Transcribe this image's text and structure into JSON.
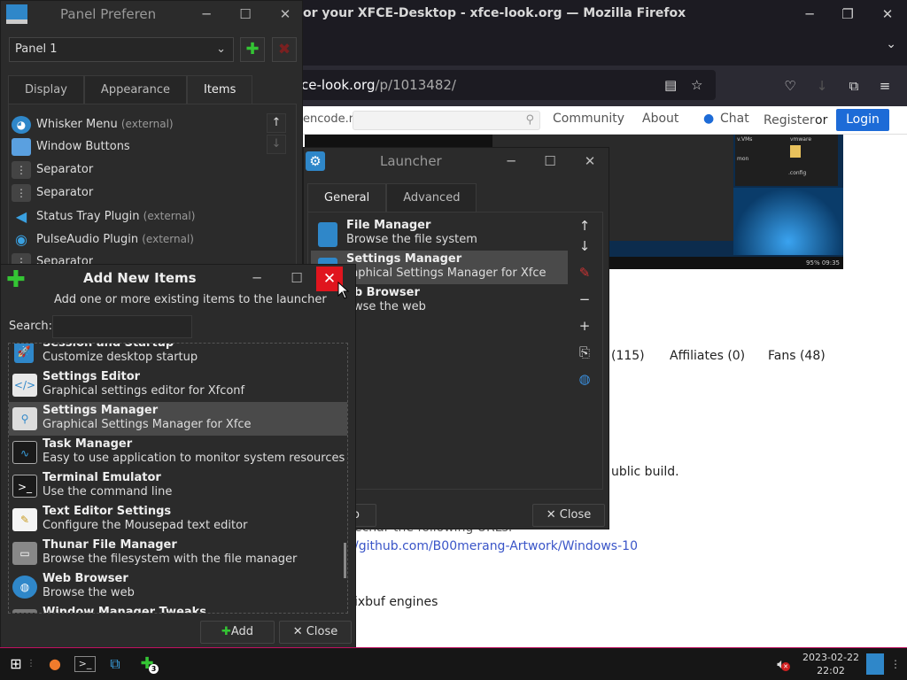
{
  "firefox": {
    "title": "or your XFCE-Desktop - xfce-look.org — Mozilla Firefox",
    "url_host": "ce-look.org",
    "url_path": "/p/1013482/",
    "site": {
      "opencode_fragment": "encode.n",
      "nav": [
        "Community",
        "About",
        "Chat"
      ],
      "register": "Register",
      "or": "or",
      "login": "Login"
    },
    "screenshot_text": {
      "vms": "v.VMs",
      "vmware": "vmware",
      "mon": "mon",
      "config": ".config",
      "status": "95% 09:35"
    },
    "tab_count_frag": "(115)",
    "affiliates": "Affiliates (0)",
    "fans": "Fans (48)",
    "public_build": "ublic build.",
    "urls_frag": "ecnar the following URLs.",
    "github_link": "/github.com/B00merang-Artwork/Windows-10",
    "pixbuf": "ixbuf engines"
  },
  "panel_prefs": {
    "title": "Panel Preferen",
    "panel_select": "Panel 1",
    "tabs": [
      "Display",
      "Appearance",
      "Items"
    ],
    "active_tab": 2,
    "items": [
      {
        "label": "Whisker Menu",
        "ext": "(external)",
        "icon": "whisker-icon"
      },
      {
        "label": "Window Buttons",
        "ext": "",
        "icon": "window-buttons-icon"
      },
      {
        "label": "Separator",
        "ext": "",
        "icon": "separator-icon"
      },
      {
        "label": "Separator",
        "ext": "",
        "icon": "separator-icon"
      },
      {
        "label": "Status Tray Plugin",
        "ext": "(external)",
        "icon": "status-tray-icon"
      },
      {
        "label": "PulseAudio Plugin",
        "ext": "(external)",
        "icon": "pulseaudio-icon"
      },
      {
        "label": "Separator",
        "ext": "",
        "icon": "separator-icon"
      }
    ]
  },
  "launcher": {
    "title": "Launcher",
    "tabs": [
      "General",
      "Advanced"
    ],
    "items": [
      {
        "name": "File Manager",
        "desc": "Browse the file system"
      },
      {
        "name": "Settings Manager",
        "desc": "raphical Settings Manager for Xfce"
      },
      {
        "name": "eb Browser",
        "desc": "owse the web"
      }
    ],
    "close_label": "Close",
    "left_btn_frag": "o"
  },
  "add_items": {
    "title": "Add New Items",
    "subtitle": "Add one or more existing items to the launcher",
    "search_label": "Search:",
    "search_value": "",
    "items": [
      {
        "name": "Session and Startup",
        "desc": "Customize desktop startup",
        "icon": "session-startup-icon"
      },
      {
        "name": "Settings Editor",
        "desc": "Graphical settings editor for Xfconf",
        "icon": "settings-editor-icon"
      },
      {
        "name": "Settings Manager",
        "desc": "Graphical Settings Manager for Xfce",
        "icon": "settings-manager-icon"
      },
      {
        "name": "Task Manager",
        "desc": "Easy to use application to monitor system resources",
        "icon": "task-manager-icon"
      },
      {
        "name": "Terminal Emulator",
        "desc": "Use the command line",
        "icon": "terminal-icon"
      },
      {
        "name": "Text Editor Settings",
        "desc": "Configure the Mousepad text editor",
        "icon": "text-editor-icon"
      },
      {
        "name": "Thunar File Manager",
        "desc": "Browse the filesystem with the file manager",
        "icon": "thunar-icon"
      },
      {
        "name": "Web Browser",
        "desc": "Browse the web",
        "icon": "web-browser-icon"
      },
      {
        "name": "Window Manager Tweaks",
        "desc": "",
        "icon": "wm-tweaks-icon"
      }
    ],
    "add_label": "Add",
    "close_label": "Close"
  },
  "taskbar": {
    "date": "2023-02-22",
    "time": "22:02",
    "badge": "3"
  }
}
